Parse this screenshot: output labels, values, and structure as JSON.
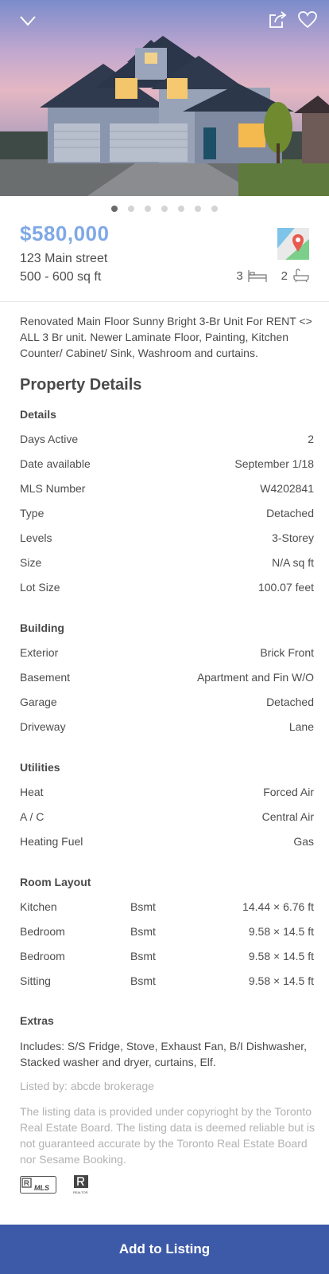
{
  "listing": {
    "price": "$580,000",
    "address": "123 Main street",
    "size_range": "500 - 600 sq ft",
    "beds": "3",
    "baths": "2",
    "image_count": 7,
    "active_image": 1,
    "description": "Renovated Main Floor Sunny Bright 3-Br Unit For RENT <> ALL 3 Br unit. Newer Laminate Floor, Painting, Kitchen Counter/ Cabinet/ Sink, Washroom and curtains."
  },
  "property_details": {
    "title": "Property Details",
    "details": {
      "title": "Details",
      "rows": [
        {
          "label": "Days Active",
          "value": "2"
        },
        {
          "label": "Date available",
          "value": "September 1/18"
        },
        {
          "label": "MLS Number",
          "value": "W4202841"
        },
        {
          "label": "Type",
          "value": "Detached"
        },
        {
          "label": "Levels",
          "value": "3-Storey"
        },
        {
          "label": "Size",
          "value": "N/A sq ft"
        },
        {
          "label": "Lot Size",
          "value": "100.07 feet"
        }
      ]
    },
    "building": {
      "title": "Building",
      "rows": [
        {
          "label": "Exterior",
          "value": "Brick Front"
        },
        {
          "label": "Basement",
          "value": "Apartment and Fin W/O"
        },
        {
          "label": "Garage",
          "value": "Detached"
        },
        {
          "label": "Driveway",
          "value": "Lane"
        }
      ]
    },
    "utilities": {
      "title": "Utilities",
      "rows": [
        {
          "label": "Heat",
          "value": "Forced Air"
        },
        {
          "label": "A / C",
          "value": "Central Air"
        },
        {
          "label": "Heating Fuel",
          "value": "Gas"
        }
      ]
    },
    "room_layout": {
      "title": "Room Layout",
      "rows": [
        {
          "room": "Kitchen",
          "level": "Bsmt",
          "dimensions": "14.44 × 6.76 ft"
        },
        {
          "room": "Bedroom",
          "level": "Bsmt",
          "dimensions": "9.58 × 14.5 ft"
        },
        {
          "room": "Bedroom",
          "level": "Bsmt",
          "dimensions": "9.58 × 14.5 ft"
        },
        {
          "room": "Sitting",
          "level": "Bsmt",
          "dimensions": "9.58 × 14.5 ft"
        }
      ]
    },
    "extras": {
      "title": "Extras",
      "text": "Includes: S/S Fridge, Stove, Exhaust Fan, B/I Dishwasher, Stacked washer and dryer, curtains, Elf."
    }
  },
  "listed_by": "Listed by: abcde brokerage",
  "disclaimer": "The listing data is provided under copyrioght by the Toronto Real Estate Board. The listing data  is deemed reliable but is not guaranteed accurate by the Toronto Real Estate Board nor Sesame Booking.",
  "logos": {
    "mls_text": "MLS",
    "realtor_text": "REALTOR"
  },
  "cta": {
    "label": "Add to Listing"
  },
  "icons": {
    "back": "chevron-down-icon",
    "share": "share-icon",
    "favorite": "heart-icon",
    "map": "map-pin-icon",
    "bed": "bed-icon",
    "bath": "bathtub-icon"
  },
  "colors": {
    "price": "#7fa8e6",
    "cta_background": "#3d5aa8",
    "muted_text": "#b2b2b2"
  }
}
